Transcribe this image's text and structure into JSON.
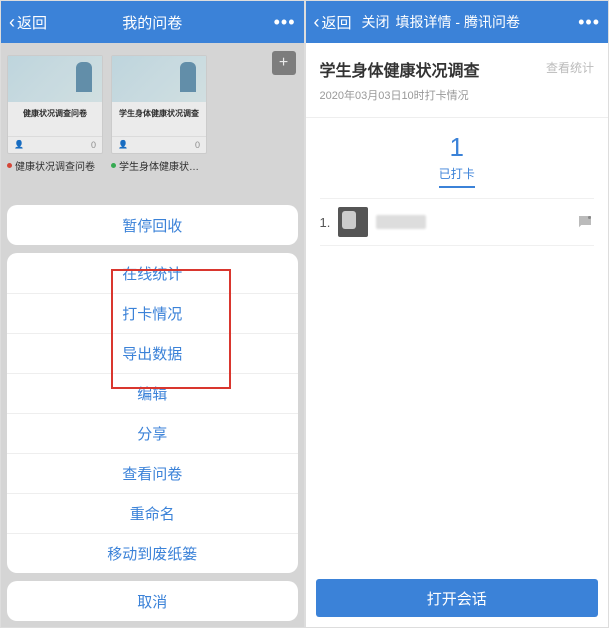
{
  "left": {
    "header": {
      "back": "返回",
      "title": "我的问卷",
      "more": "•••"
    },
    "cards": [
      {
        "title": "健康状况调查问卷",
        "thumbTitle": "健康状况调查问卷",
        "thumbDesc": "",
        "count": "0",
        "dotColor": "red"
      },
      {
        "title": "学生身体健康状…",
        "thumbTitle": "学生身体健康状况调查",
        "thumbDesc": "",
        "count": "0",
        "dotColor": "green"
      }
    ],
    "sheet": {
      "pause": "暂停回收",
      "items": [
        "在线统计",
        "打卡情况",
        "导出数据",
        "编辑",
        "分享",
        "查看问卷",
        "重命名",
        "移动到废纸篓"
      ],
      "cancel": "取消"
    }
  },
  "right": {
    "header": {
      "back": "返回",
      "close": "关闭",
      "title": "填报详情 - 腾讯问卷",
      "more": "•••"
    },
    "survey": {
      "title": "学生身体健康状况调查",
      "viewStats": "查看统计",
      "date": "2020年03月03日10时打卡情况"
    },
    "count": {
      "num": "1",
      "label": "已打卡"
    },
    "entries": [
      {
        "idx": "1."
      }
    ],
    "bottomButton": "打开会话"
  }
}
